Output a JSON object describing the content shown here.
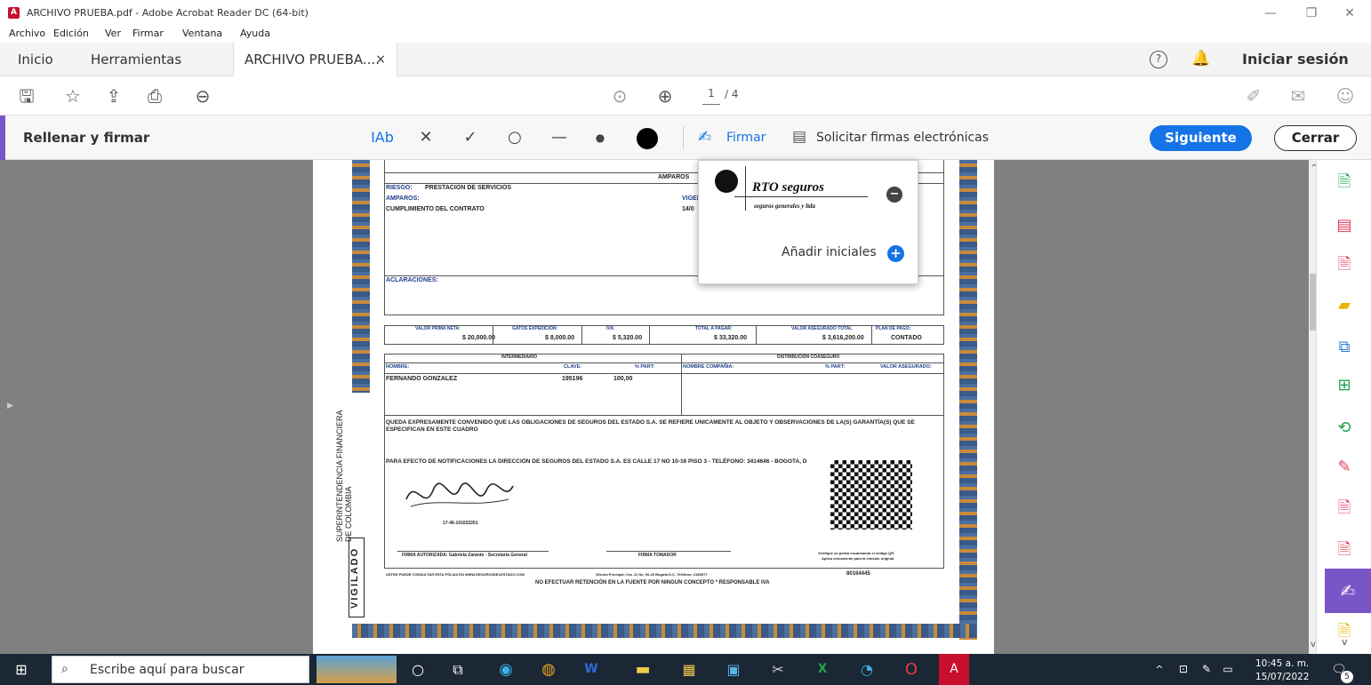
{
  "window": {
    "title": "ARCHIVO PRUEBA.pdf - Adobe Acrobat Reader DC (64-bit)",
    "pdf_icon": "pdf-app-icon"
  },
  "menu": [
    "Archivo",
    "Edición",
    "Ver",
    "Firmar",
    "Ventana",
    "Ayuda"
  ],
  "tabs": {
    "home": "Inicio",
    "tools": "Herramientas",
    "doc": "ARCHIVO PRUEBA....",
    "close": "×",
    "signin": "Iniciar sesión"
  },
  "toolbar": {
    "page_current": "1",
    "page_total": "/ 4"
  },
  "fill_sign": {
    "title": "Rellenar y firmar",
    "text_tool": "IAb",
    "sign": "Firmar",
    "request": "Solicitar firmas electrónicas",
    "next": "Siguiente",
    "close": "Cerrar"
  },
  "popup": {
    "signature_name": "RTO seguros",
    "signature_sub": "seguros generales y ltda",
    "add_initials": "Añadir iniciales"
  },
  "document": {
    "amparos": "AMPAROS",
    "riesgo_label": "RIESGO:",
    "riesgo_value": "PRESTACION DE SERVICIOS",
    "amparos_label": "AMPAROS:",
    "vigen": "VIGEN",
    "cumplimiento": "CUMPLIMIENTO DEL CONTRATO",
    "fecha": "14/0",
    "aclaraciones": "ACLARACIONES:",
    "col_prima": "VALOR PRIMA NETA:",
    "col_gastos": "GATOS EXPEDICIÓN:",
    "col_iva": "IVA:",
    "col_total": "TOTAL A PAGAR:",
    "col_asegurado": "VALOR ASEGURADO TOTAL",
    "col_plan": "PLAN DE PAGO:",
    "val_prima": "$ 20,000.00",
    "val_gastos": "$ 8,000.00",
    "val_iva": "$ 5,320.00",
    "val_total": "$ 33,320.00",
    "val_asegurado": "$ 3,616,200.00",
    "val_plan": "CONTADO",
    "intermediario": "INTERMEDIARIO",
    "coaseguro": "DISTRIBUCIÓN COASEGURO",
    "nombre_label": "NOMBRE:",
    "clave_label": "CLAVE:",
    "part_label": "% PART:",
    "compania_label": "NOMBRE COMPAÑIA:",
    "part2_label": "% PART:",
    "valaseg_label": "VALOR ASEGURADO:",
    "nombre_value": "FERNANDO GONZALEZ",
    "clave_value": "195196",
    "part_value": "100,00",
    "clausula": "QUEDA EXPRESAMENTE CONVENIDO QUE LAS OBLIGACIONES DE SEGUROS DEL ESTADO S.A. SE REFIERE UNICAMENTE AL OBJETO Y OBSERVACIONES DE LA(S) GARANTÍA(S) QUE SE",
    "clausula2": "ESPECIFICAN EN ESTE CUADRO",
    "notificaciones": "PARA EFECTO DE NOTIFICACIONES LA DIRECCIÓN DE SEGUROS DEL ESTADO S.A. ES CALLE 17 NO 10-16 PISO 3 - TELÉFONO: 3414646 - BOGOTA, D",
    "sello_code": "17-46-101022201",
    "firma_autorizada": "FIRMA AUTORIZADA: Gabriela Zarante - Secretaria General",
    "firma_tomador": "FIRMA TOMADOR",
    "verifique": "Verifique su póliza escaneando el código QR.",
    "verifique2": "Aplica únicamente para la emisión original.",
    "consultar": "USTED PUEDE CONSULTAR ESTA PÓLIZA EN WWW.SEGUROSDELESTADO.COM",
    "oficina": "Oficina Principal: Cra. 11 No. 90-20 Bogotá D.C. Teléfono: 2189977",
    "numero": "80164445",
    "no_retencion": "NO EFECTUAR RETENCIÓN EN LA FUENTE POR NINGUN CONCEPTO * RESPONSABLE IVA",
    "superintendencia": "SUPERINTENDENCIA FINANCIERA DE COLOMBIA",
    "vigilado": "VIGILADO"
  },
  "taskbar": {
    "search_placeholder": "Escribe aquí para buscar",
    "time": "10:45 a. m.",
    "date": "15/07/2022",
    "notif_count": "5"
  },
  "colors": {
    "accent_blue": "#1473e6",
    "fill_sign_purple": "#7a55c7",
    "taskbar": "#1b2734"
  }
}
